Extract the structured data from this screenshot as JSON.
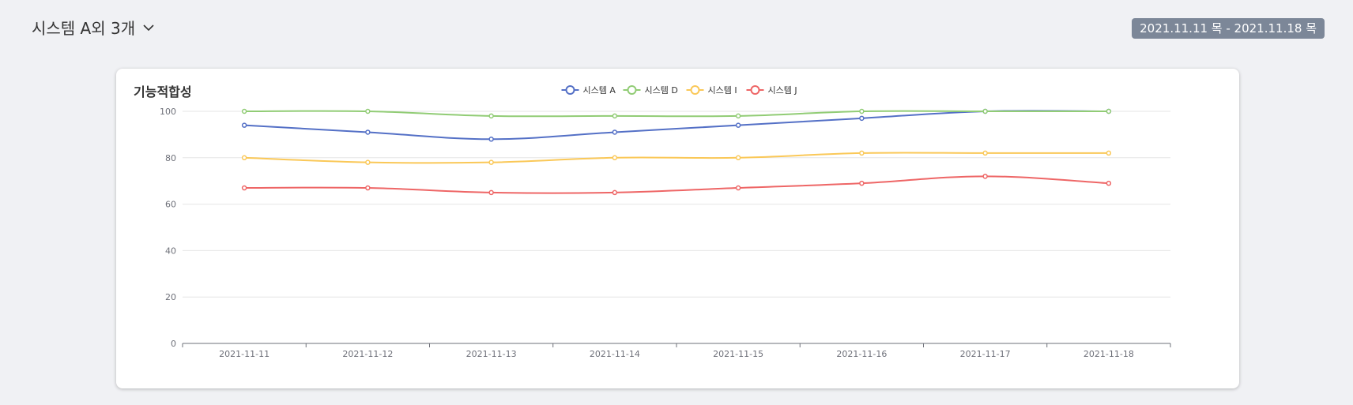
{
  "header": {
    "title": "시스템 A외 3개"
  },
  "date_range": "2021.11.11 목 - 2021.11.18 목",
  "chart_data": {
    "type": "line",
    "title": "기능적합성",
    "x": [
      "2021-11-11",
      "2021-11-12",
      "2021-11-13",
      "2021-11-14",
      "2021-11-15",
      "2021-11-16",
      "2021-11-17",
      "2021-11-18"
    ],
    "ylim": [
      0,
      100
    ],
    "yticks": [
      0,
      20,
      40,
      60,
      80,
      100
    ],
    "grid": true,
    "legend_position": "top-center",
    "series": [
      {
        "name": "시스템 A",
        "color": "#5470c6",
        "values": [
          94,
          91,
          88,
          91,
          94,
          97,
          100,
          100
        ]
      },
      {
        "name": "시스템 D",
        "color": "#91cc75",
        "values": [
          100,
          100,
          98,
          98,
          98,
          100,
          100,
          100
        ]
      },
      {
        "name": "시스템 I",
        "color": "#fac858",
        "values": [
          80,
          78,
          78,
          80,
          80,
          82,
          82,
          82
        ]
      },
      {
        "name": "시스템 J",
        "color": "#ee6666",
        "values": [
          67,
          67,
          65,
          65,
          67,
          69,
          72,
          69
        ]
      }
    ]
  }
}
